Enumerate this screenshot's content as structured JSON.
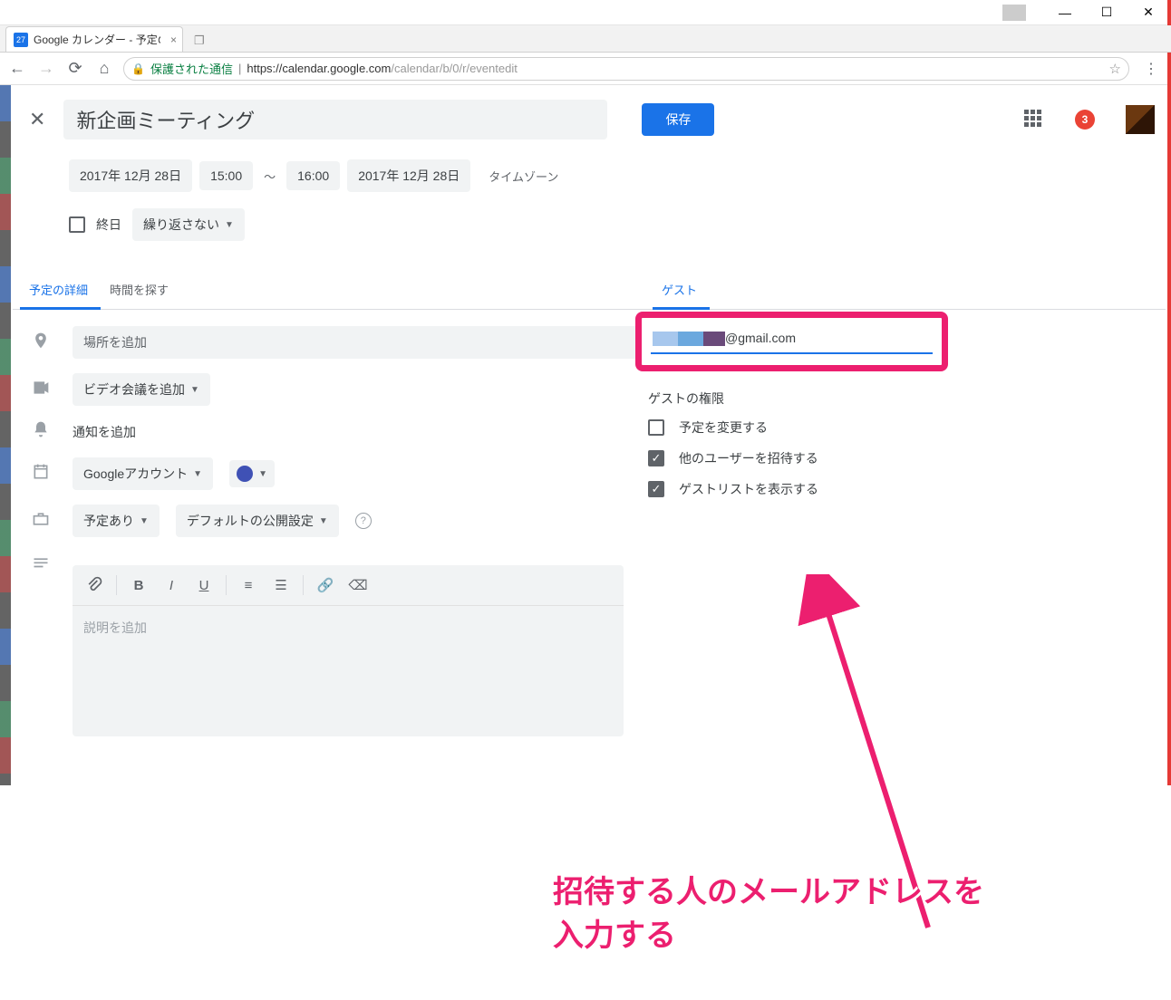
{
  "window": {
    "tab_title": "Google カレンダー - 予定の",
    "favicon_day": "27",
    "secure_label": "保護された通信",
    "url_host": "https://calendar.google.com",
    "url_path": "/calendar/b/0/r/eventedit"
  },
  "header": {
    "title_value": "新企画ミーティング",
    "save_label": "保存",
    "notif_count": "3"
  },
  "datetime": {
    "start_date": "2017年 12月 28日",
    "start_time": "15:00",
    "end_time": "16:00",
    "end_date": "2017年 12月 28日",
    "tz_label": "タイムゾーン",
    "allday_label": "終日",
    "repeat_label": "繰り返さない"
  },
  "tabs": {
    "details": "予定の詳細",
    "findtime": "時間を探す",
    "guests": "ゲスト"
  },
  "form": {
    "location_placeholder": "場所を追加",
    "video_label": "ビデオ会議を追加",
    "notify_label": "通知を追加",
    "calendar_label": "Googleアカウント",
    "avail_label": "予定あり",
    "visibility_label": "デフォルトの公開設定",
    "description_placeholder": "説明を追加"
  },
  "guest": {
    "input_value": "@gmail.com",
    "perm_title": "ゲストの権限",
    "perm_modify": "予定を変更する",
    "perm_invite": "他のユーザーを招待する",
    "perm_seelist": "ゲストリストを表示する"
  },
  "annotation": {
    "text1": "招待する人のメールアドレスを",
    "text2": "入力する"
  }
}
